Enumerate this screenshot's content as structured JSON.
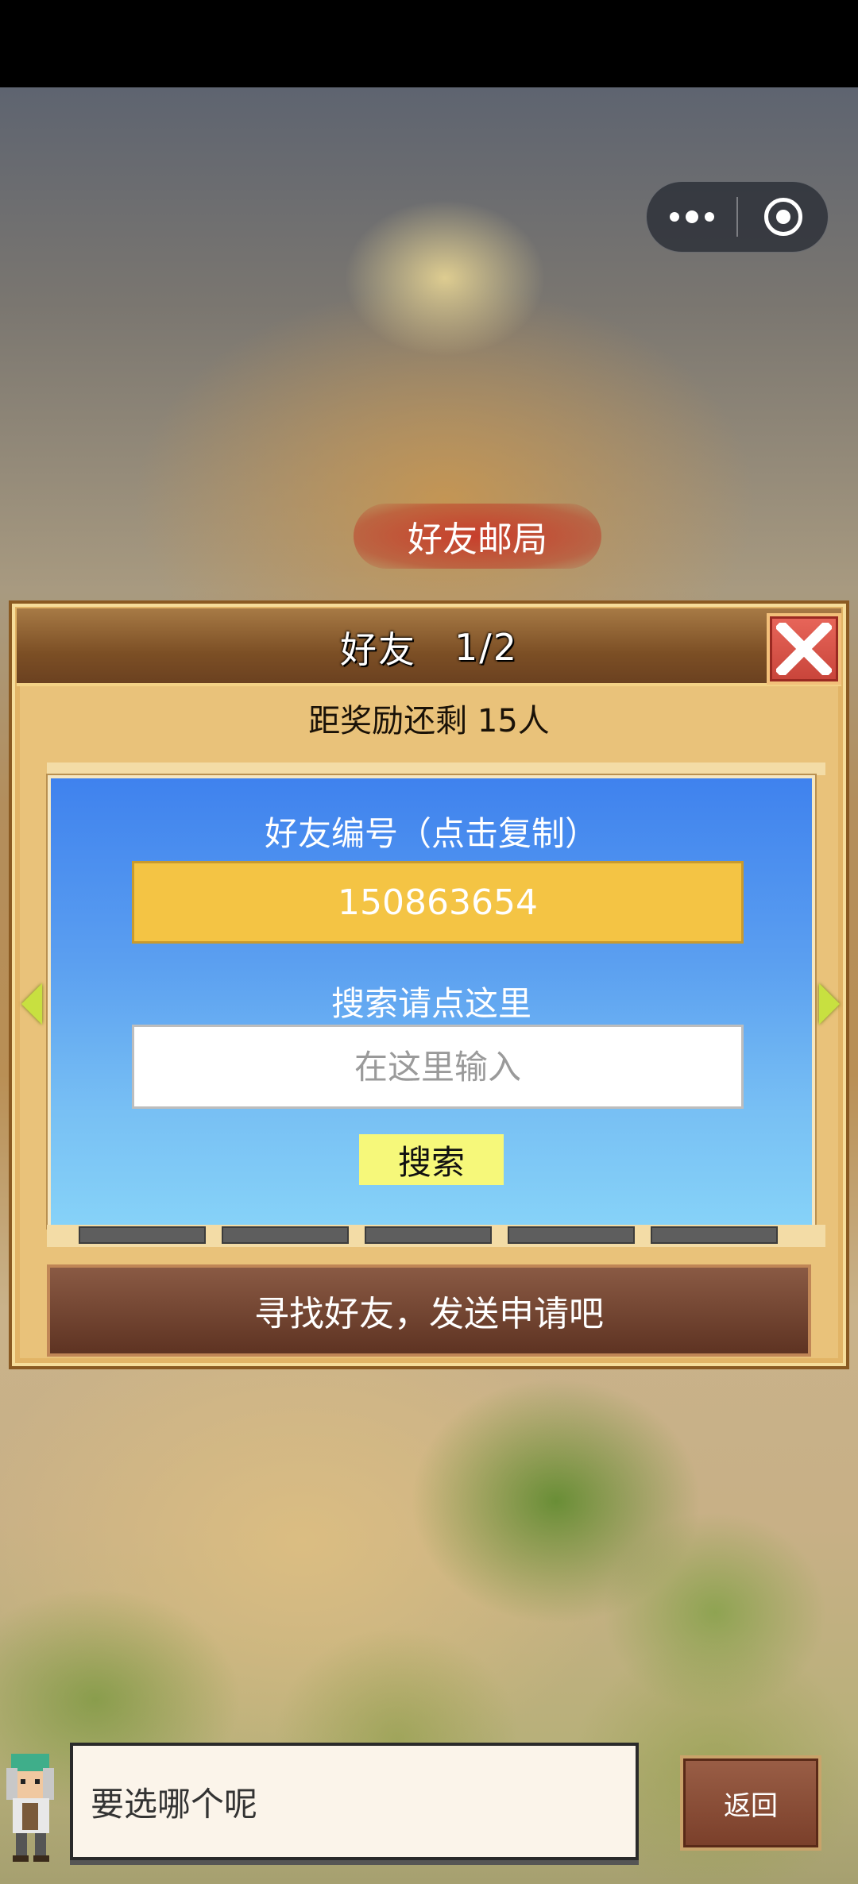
{
  "sign": {
    "label": "好友邮局"
  },
  "dialog": {
    "title": "好友",
    "page": "1/2",
    "reward_text": "距奖励还剩 15人",
    "friend_id_label": "好友编号（点击复制）",
    "friend_id": "150863654",
    "search_label": "搜索请点这里",
    "search_placeholder": "在这里输入",
    "search_button": "搜索",
    "action_text": "寻找好友，发送申请吧"
  },
  "bottom": {
    "speech_text": "要选哪个呢",
    "back_button": "返回"
  },
  "colors": {
    "panel": "#e9c27a",
    "id_box": "#f4c444",
    "search_button": "#f6f87a",
    "close_button": "#d9534a",
    "arrow": "#c8e040"
  }
}
